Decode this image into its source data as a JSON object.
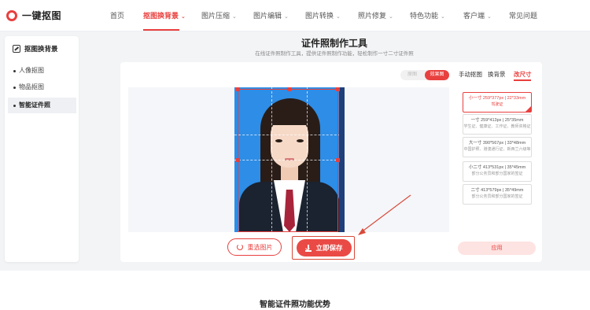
{
  "app": {
    "logo_text": "一键抠图"
  },
  "nav": {
    "items": [
      {
        "label": "首页",
        "caret": ""
      },
      {
        "label": "抠图换背景",
        "caret": "⌄"
      },
      {
        "label": "图片压缩",
        "caret": "⌄"
      },
      {
        "label": "图片编辑",
        "caret": "⌄"
      },
      {
        "label": "图片转换",
        "caret": "⌄"
      },
      {
        "label": "照片修复",
        "caret": "⌄"
      },
      {
        "label": "特色功能",
        "caret": "⌄"
      },
      {
        "label": "客户端",
        "caret": "⌄"
      },
      {
        "label": "常见问题",
        "caret": ""
      }
    ],
    "active_index": 1
  },
  "sidebar": {
    "heading": "抠图换背景",
    "items": [
      {
        "label": "人像抠图"
      },
      {
        "label": "物品抠图"
      },
      {
        "label": "智能证件照"
      }
    ],
    "active_index": 2
  },
  "page": {
    "title": "证件照制作工具",
    "subtitle": "在线证件照制作工具，提供证件照制作功能，轻松制作一寸二寸证件照"
  },
  "preview_toggle": {
    "original": "原图",
    "result": "效果图",
    "selected": "效果图"
  },
  "panel": {
    "tabs": [
      "手动抠图",
      "换背景",
      "改尺寸"
    ],
    "active_tab": "改尺寸",
    "sizes": [
      {
        "title": "小一寸 259*377px | 22*33mm",
        "desc": "驾驶证"
      },
      {
        "title": "一寸 259*413px | 25*35mm",
        "desc": "学生证、健康证、工作证、教师资格证"
      },
      {
        "title": "大一寸 390*567px | 33*48mm",
        "desc": "中国护照、港澳通行证、新西兰六级等"
      },
      {
        "title": "小二寸 413*531px | 35*45mm",
        "desc": "部分公务员和部分国家的签证"
      },
      {
        "title": "二寸 413*579px | 35*49mm",
        "desc": "部分公务员和部分国家的签证"
      }
    ],
    "selected_size_index": 0,
    "apply_label": "应用"
  },
  "actions": {
    "reselect_label": "重选图片",
    "save_label": "立即保存"
  },
  "lower": {
    "title": "智能证件照功能优势"
  },
  "colors": {
    "accent": "#e8403e",
    "photo_background": "#2e8de6"
  }
}
